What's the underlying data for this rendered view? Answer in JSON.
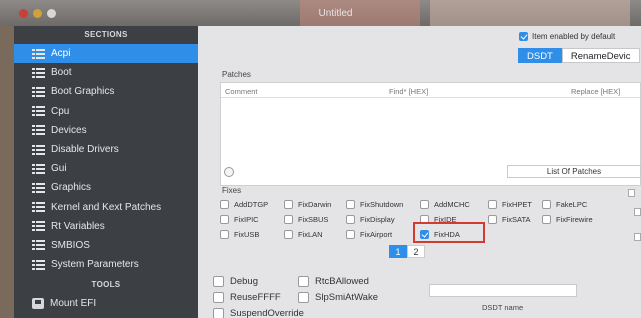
{
  "window": {
    "title": "Untitled"
  },
  "sidebar": {
    "sections_header": "SECTIONS",
    "items": [
      {
        "label": "Acpi",
        "active": true
      },
      {
        "label": "Boot"
      },
      {
        "label": "Boot Graphics"
      },
      {
        "label": "Cpu"
      },
      {
        "label": "Devices"
      },
      {
        "label": "Disable Drivers"
      },
      {
        "label": "Gui"
      },
      {
        "label": "Graphics"
      },
      {
        "label": "Kernel and Kext Patches"
      },
      {
        "label": "Rt Variables"
      },
      {
        "label": "SMBIOS"
      },
      {
        "label": "System Parameters"
      }
    ],
    "tools_header": "TOOLS",
    "tools": [
      {
        "label": "Mount EFI"
      }
    ]
  },
  "main": {
    "item_enabled_label": "Item enabled by default",
    "tabs": [
      {
        "label": "DSDT",
        "active": true
      },
      {
        "label": "RenameDevic"
      }
    ],
    "patches_label": "Patches",
    "patch_columns": {
      "comment": "Comment",
      "find": "Find* [HEX]",
      "replace": "Replace [HEX]"
    },
    "list_of_patches_button": "List Of Patches",
    "fixes_label": "Fixes",
    "fixes": [
      {
        "label": "AddDTGP",
        "checked": false
      },
      {
        "label": "FixDarwin",
        "checked": false
      },
      {
        "label": "FixShutdown",
        "checked": false
      },
      {
        "label": "AddMCHC",
        "checked": false
      },
      {
        "label": "FixHPET",
        "checked": false
      },
      {
        "label": "FakeLPC",
        "checked": false
      },
      {
        "label": "FixIPIC",
        "checked": false
      },
      {
        "label": "FixSBUS",
        "checked": false
      },
      {
        "label": "FixDisplay",
        "checked": false
      },
      {
        "label": "FixIDE",
        "checked": false
      },
      {
        "label": "FixSATA",
        "checked": false
      },
      {
        "label": "FixFirewire",
        "checked": false
      },
      {
        "label": "FixUSB",
        "checked": false
      },
      {
        "label": "FixLAN",
        "checked": false
      },
      {
        "label": "FixAirport",
        "checked": false
      },
      {
        "label": "FixHDA",
        "checked": true
      }
    ],
    "pages": [
      "1",
      "2"
    ],
    "current_page": "1",
    "options": [
      {
        "label": "Debug",
        "checked": false
      },
      {
        "label": "RtcBAllowed",
        "checked": false
      },
      {
        "label": "ReuseFFFF",
        "checked": false
      },
      {
        "label": "SlpSmiAtWake",
        "checked": false
      },
      {
        "label": "SuspendOverride",
        "checked": false
      }
    ],
    "dsdt_name_label": "DSDT name",
    "dsdt_name_value": ""
  },
  "colors": {
    "accent": "#2f8fe8",
    "sidebar_bg": "#3c3f44",
    "highlight_box": "#d43a32"
  }
}
